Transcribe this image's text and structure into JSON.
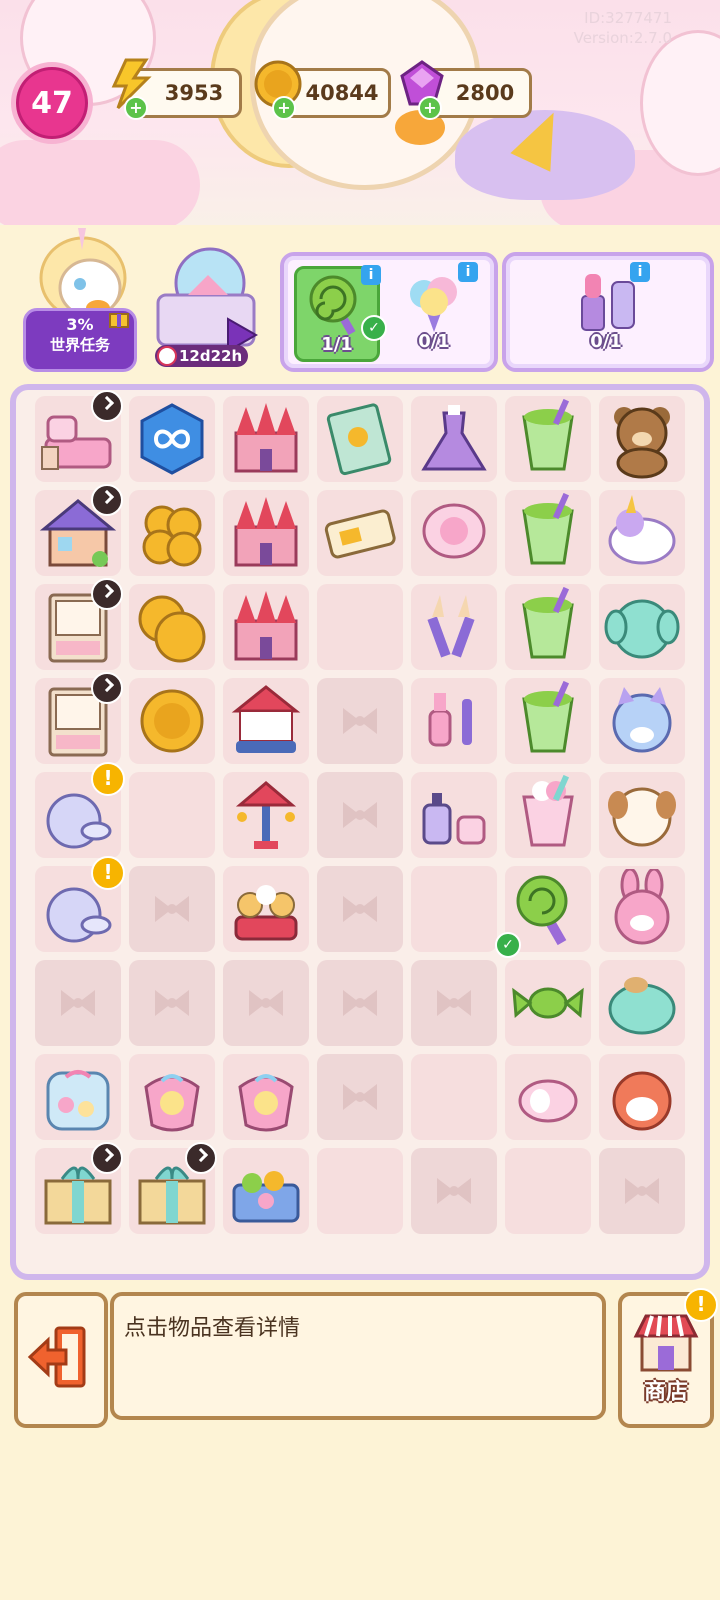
{
  "header": {
    "id_text": "ID:3277471",
    "version_text": "Version:2.7.0",
    "level": "47",
    "energy": "3953",
    "coins": "40844",
    "gems": "2800"
  },
  "tasks": {
    "world_task_percent": "3%",
    "world_task_label": "世界任务",
    "event_timer": "12d22h",
    "orders": [
      {
        "name": "lollipop",
        "count": "1/1",
        "done": true
      },
      {
        "name": "cotton-candy",
        "count": "0/1",
        "done": false
      },
      {
        "name": "cosmetics",
        "count": "0/1",
        "done": false
      }
    ]
  },
  "board": {
    "rows": [
      [
        "bed",
        "infinity-token",
        "castle",
        "book",
        "dress",
        "green-drink",
        "teddy-bear"
      ],
      [
        "house",
        "coin-stack",
        "castle",
        "ticket",
        "compact",
        "green-drink",
        "unicorn-plush"
      ],
      [
        "cabinet",
        "coin-double",
        "castle",
        "empty",
        "brushes",
        "green-drink",
        "elephant-plush"
      ],
      [
        "cabinet",
        "coin",
        "carousel",
        "locked",
        "lipstick-roller",
        "green-drink",
        "cat-plush"
      ],
      [
        "jar",
        "empty",
        "swing-ride",
        "locked",
        "perfume-set",
        "pink-drink",
        "dog-plush"
      ],
      [
        "jar",
        "locked",
        "teacup-ride",
        "locked",
        "empty",
        "lollipop",
        "bunny-plush"
      ],
      [
        "locked",
        "locked",
        "locked",
        "locked",
        "locked",
        "candy",
        "seal-plush"
      ],
      [
        "candy-jar",
        "candy-bag",
        "candy-bag",
        "locked",
        "empty",
        "mochi",
        "hamster-plush"
      ],
      [
        "gift-box",
        "gift-box",
        "candy-tray",
        "empty",
        "locked",
        "empty",
        "locked"
      ]
    ]
  },
  "footer": {
    "info_text": "点击物品查看详情",
    "shop_label": "商店"
  }
}
